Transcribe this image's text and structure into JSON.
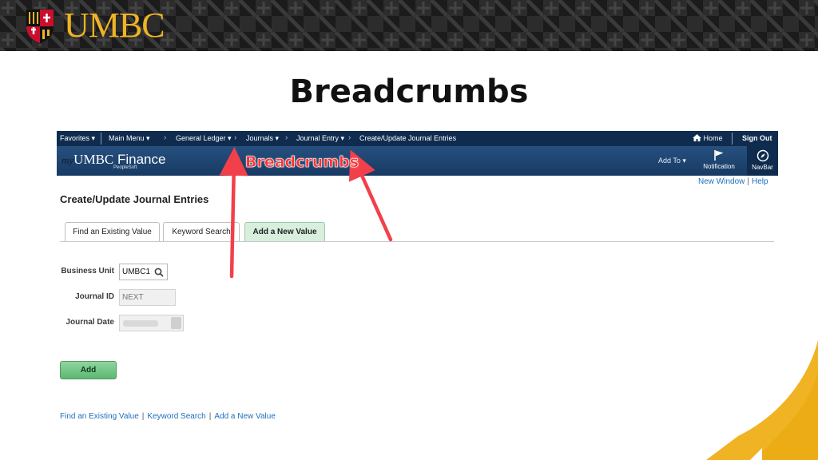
{
  "banner": {
    "wordmark": "UMBC"
  },
  "slide": {
    "title": "Breadcrumbs"
  },
  "topnav": {
    "favorites": "Favorites",
    "main_menu": "Main Menu",
    "breadcrumbs": [
      "General Ledger",
      "Journals",
      "Journal Entry",
      "Create/Update Journal Entries"
    ],
    "home": "Home",
    "sign_out": "Sign Out"
  },
  "appbar": {
    "brand_prefix": "my",
    "brand_name": "UMBC",
    "brand_suffix": "Finance",
    "brand_sub": "PeopleSoft",
    "add_to": "Add To",
    "notification": "Notification",
    "navbar": "NavBar"
  },
  "page_links": {
    "new_window": "New Window",
    "help": "Help"
  },
  "page": {
    "heading": "Create/Update Journal Entries"
  },
  "tabs": [
    {
      "label": "Find an Existing Value",
      "active": false
    },
    {
      "label": "Keyword Search",
      "active": false
    },
    {
      "label": "Add a New Value",
      "active": true
    }
  ],
  "form": {
    "business_unit": {
      "label": "Business Unit",
      "value": "UMBC1"
    },
    "journal_id": {
      "label": "Journal ID",
      "value": "NEXT"
    },
    "journal_date": {
      "label": "Journal Date"
    }
  },
  "add_button": "Add",
  "bottom_links": [
    "Find an Existing Value",
    "Keyword Search",
    "Add a New Value"
  ],
  "annotation": {
    "label": "Breadcrumbs"
  },
  "colors": {
    "banner_bg": "#161616",
    "umbc_gold": "#f0b323",
    "nav_bg": "#0f2b4e",
    "appbar_bg": "#1f4670",
    "link_blue": "#1d6fbf",
    "active_tab": "#d7efdc",
    "add_button": "#6cc283",
    "annotation_red": "#ff3030"
  }
}
